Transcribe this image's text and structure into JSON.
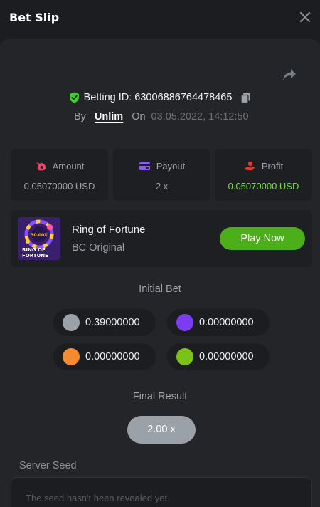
{
  "header": {
    "title": "Bet Slip"
  },
  "bet": {
    "id_label": "Betting ID: 6300688676447846​5",
    "by_label": "By",
    "user": "Unlim",
    "on_label": "On",
    "date": "03.05.2022, 14:12:50"
  },
  "stats": {
    "amount": {
      "label": "Amount",
      "value": "0.05070000 USD",
      "icon": "money-bag-icon"
    },
    "payout": {
      "label": "Payout",
      "value": "2 x",
      "icon": "card-icon"
    },
    "profit": {
      "label": "Profit",
      "value": "0.05070000 USD",
      "icon": "hand-coin-icon"
    }
  },
  "game": {
    "name": "Ring of Fortune",
    "provider": "BC Original",
    "play_label": "Play Now",
    "thumb_text_top": "30.00X",
    "thumb_text": "RING OF\nFORTUNE"
  },
  "initial_bet": {
    "label": "Initial Bet",
    "items": [
      {
        "color": "#9ba1a9",
        "value": "0.39000000"
      },
      {
        "color": "#7b3cf2",
        "value": "0.00000000"
      },
      {
        "color": "#f58a2e",
        "value": "0.00000000"
      },
      {
        "color": "#7ac11a",
        "value": "0.00000000"
      }
    ]
  },
  "final_result": {
    "label": "Final Result",
    "value": "2.00 x"
  },
  "server_seed": {
    "label": "Server Seed",
    "text": "The seed hasn't been revealed yet."
  },
  "colors": {
    "accent_green": "#4caf1a",
    "profit_green": "#6fe03a",
    "panel": "#232528",
    "background": "#1b1d20"
  }
}
